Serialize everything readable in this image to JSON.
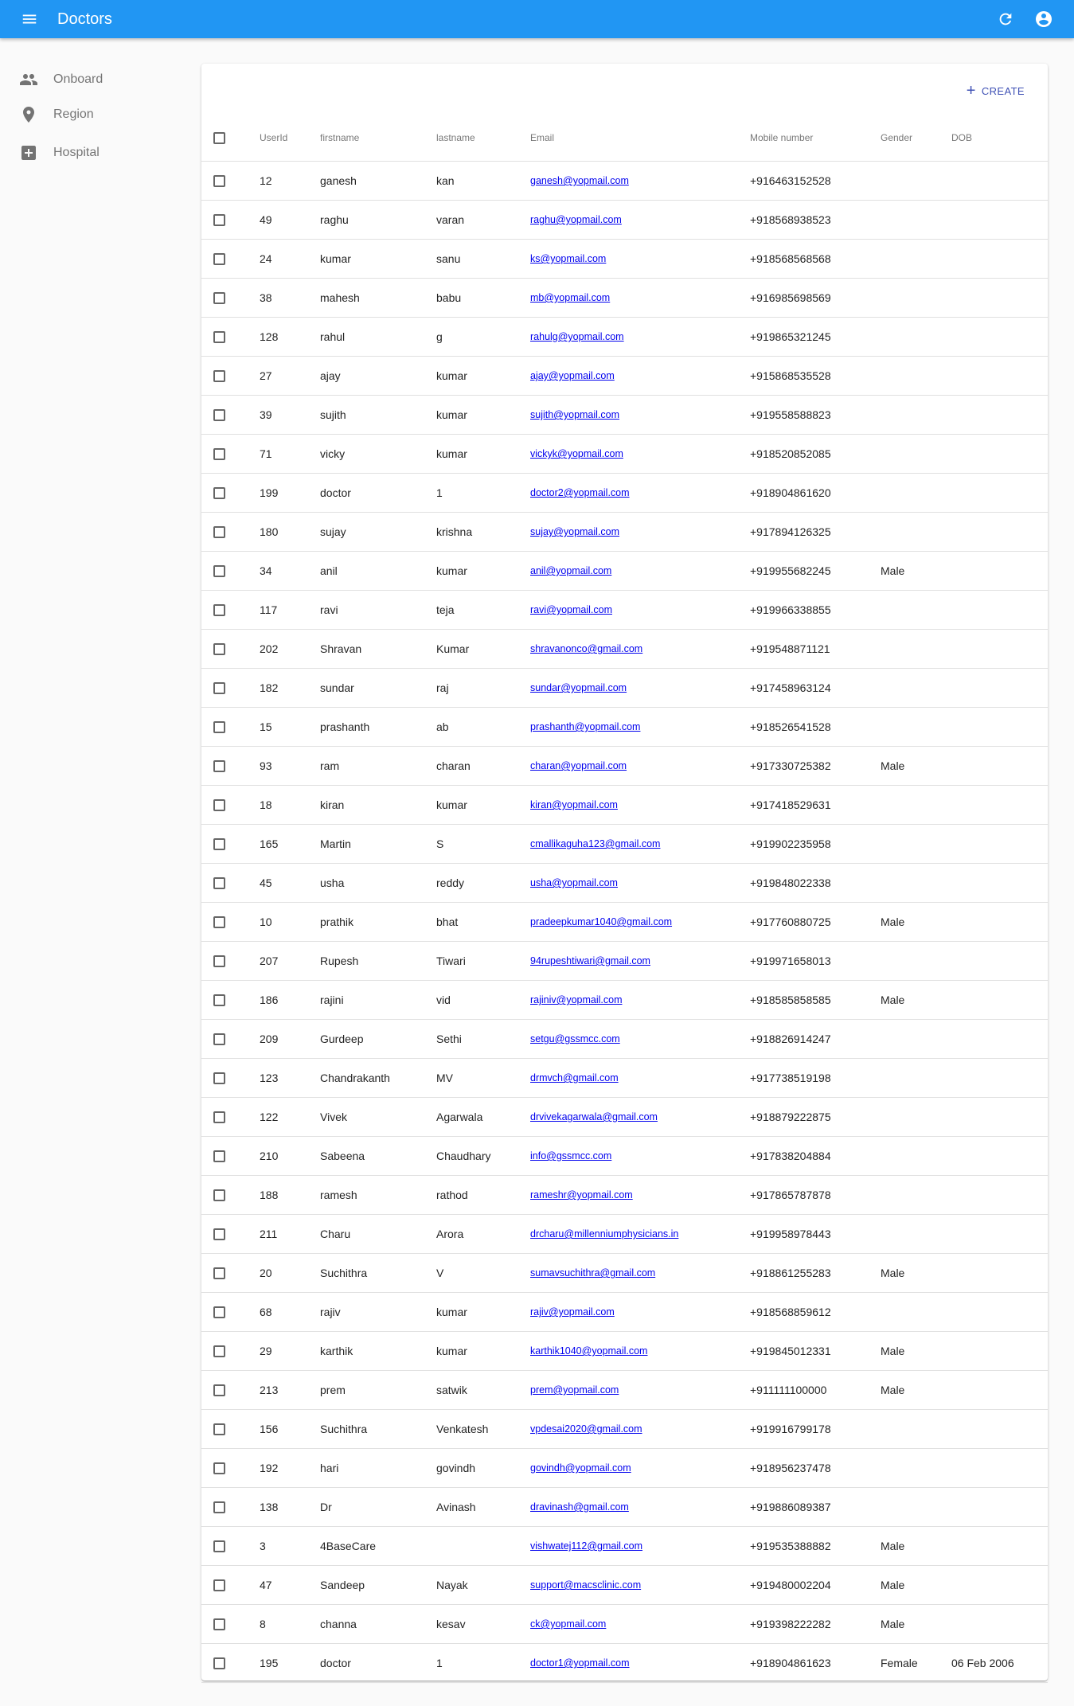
{
  "appbar": {
    "title": "Doctors",
    "menu_icon": "menu-icon",
    "refresh_icon": "refresh-icon",
    "account_icon": "account-circle-icon",
    "color": "#2196f3"
  },
  "sidebar": {
    "items": [
      {
        "label": "Onboard",
        "icon": "people-icon"
      },
      {
        "label": "Region",
        "icon": "location-pin-icon"
      },
      {
        "label": "Hospital",
        "icon": "hospital-plus-icon"
      }
    ]
  },
  "toolbar": {
    "create_label": "CREATE",
    "create_icon": "plus-icon",
    "accent": "#3f51b5"
  },
  "table": {
    "headers": {
      "userid": "UserId",
      "firstname": "firstname",
      "lastname": "lastname",
      "email": "Email",
      "mobile": "Mobile number",
      "gender": "Gender",
      "dob": "DOB"
    },
    "rows": [
      {
        "id": "12",
        "first": "ganesh",
        "last": "kan",
        "email": "ganesh@yopmail.com",
        "mobile": "+916463152528",
        "gender": "",
        "dob": ""
      },
      {
        "id": "49",
        "first": "raghu",
        "last": "varan",
        "email": "raghu@yopmail.com",
        "mobile": "+918568938523",
        "gender": "",
        "dob": ""
      },
      {
        "id": "24",
        "first": "kumar",
        "last": "sanu",
        "email": "ks@yopmail.com",
        "mobile": "+918568568568",
        "gender": "",
        "dob": ""
      },
      {
        "id": "38",
        "first": "mahesh",
        "last": "babu",
        "email": "mb@yopmail.com",
        "mobile": "+916985698569",
        "gender": "",
        "dob": ""
      },
      {
        "id": "128",
        "first": "rahul",
        "last": "g",
        "email": "rahulg@yopmail.com",
        "mobile": "+919865321245",
        "gender": "",
        "dob": ""
      },
      {
        "id": "27",
        "first": "ajay",
        "last": "kumar",
        "email": "ajay@yopmail.com",
        "mobile": "+915868535528",
        "gender": "",
        "dob": ""
      },
      {
        "id": "39",
        "first": "sujith",
        "last": "kumar",
        "email": "sujith@yopmail.com",
        "mobile": "+919558588823",
        "gender": "",
        "dob": ""
      },
      {
        "id": "71",
        "first": "vicky",
        "last": "kumar",
        "email": "vickyk@yopmail.com",
        "mobile": "+918520852085",
        "gender": "",
        "dob": ""
      },
      {
        "id": "199",
        "first": "doctor",
        "last": "1",
        "email": "doctor2@yopmail.com",
        "mobile": "+918904861620",
        "gender": "",
        "dob": ""
      },
      {
        "id": "180",
        "first": "sujay",
        "last": "krishna",
        "email": "sujay@yopmail.com",
        "mobile": "+917894126325",
        "gender": "",
        "dob": ""
      },
      {
        "id": "34",
        "first": "anil",
        "last": "kumar",
        "email": "anil@yopmail.com",
        "mobile": "+919955682245",
        "gender": "Male",
        "dob": ""
      },
      {
        "id": "117",
        "first": "ravi",
        "last": "teja",
        "email": "ravi@yopmail.com",
        "mobile": "+919966338855",
        "gender": "",
        "dob": ""
      },
      {
        "id": "202",
        "first": "Shravan",
        "last": "Kumar",
        "email": "shravanonco@gmail.com",
        "mobile": "+919548871121",
        "gender": "",
        "dob": ""
      },
      {
        "id": "182",
        "first": "sundar",
        "last": "raj",
        "email": "sundar@yopmail.com",
        "mobile": "+917458963124",
        "gender": "",
        "dob": ""
      },
      {
        "id": "15",
        "first": "prashanth",
        "last": "ab",
        "email": "prashanth@yopmail.com",
        "mobile": "+918526541528",
        "gender": "",
        "dob": ""
      },
      {
        "id": "93",
        "first": "ram",
        "last": "charan",
        "email": "charan@yopmail.com",
        "mobile": "+917330725382",
        "gender": "Male",
        "dob": ""
      },
      {
        "id": "18",
        "first": "kiran",
        "last": "kumar",
        "email": "kiran@yopmail.com",
        "mobile": "+917418529631",
        "gender": "",
        "dob": ""
      },
      {
        "id": "165",
        "first": "Martin",
        "last": "S",
        "email": "cmallikaguha123@gmail.com",
        "mobile": "+919902235958",
        "gender": "",
        "dob": ""
      },
      {
        "id": "45",
        "first": "usha",
        "last": "reddy",
        "email": "usha@yopmail.com",
        "mobile": "+919848022338",
        "gender": "",
        "dob": ""
      },
      {
        "id": "10",
        "first": "prathik",
        "last": "bhat",
        "email": "pradeepkumar1040@gmail.com",
        "mobile": "+917760880725",
        "gender": "Male",
        "dob": ""
      },
      {
        "id": "207",
        "first": "Rupesh",
        "last": "Tiwari",
        "email": "94rupeshtiwari@gmail.com",
        "mobile": "+919971658013",
        "gender": "",
        "dob": ""
      },
      {
        "id": "186",
        "first": "rajini",
        "last": "vid",
        "email": "rajiniv@yopmail.com",
        "mobile": "+918585858585",
        "gender": "Male",
        "dob": ""
      },
      {
        "id": "209",
        "first": "Gurdeep",
        "last": "Sethi",
        "email": "setgu@gssmcc.com",
        "mobile": "+918826914247",
        "gender": "",
        "dob": ""
      },
      {
        "id": "123",
        "first": "Chandrakanth",
        "last": "MV",
        "email": "drmvch@gmail.com",
        "mobile": "+917738519198",
        "gender": "",
        "dob": ""
      },
      {
        "id": "122",
        "first": "Vivek",
        "last": "Agarwala",
        "email": "drvivekagarwala@gmail.com",
        "mobile": "+918879222875",
        "gender": "",
        "dob": ""
      },
      {
        "id": "210",
        "first": "Sabeena",
        "last": "Chaudhary",
        "email": "info@gssmcc.com",
        "mobile": "+917838204884",
        "gender": "",
        "dob": ""
      },
      {
        "id": "188",
        "first": "ramesh",
        "last": "rathod",
        "email": "rameshr@yopmail.com",
        "mobile": "+917865787878",
        "gender": "",
        "dob": ""
      },
      {
        "id": "211",
        "first": "Charu",
        "last": "Arora",
        "email": "drcharu@millenniumphysicians.in",
        "mobile": "+919958978443",
        "gender": "",
        "dob": ""
      },
      {
        "id": "20",
        "first": "Suchithra",
        "last": "V",
        "email": "sumavsuchithra@gmail.com",
        "mobile": "+918861255283",
        "gender": "Male",
        "dob": ""
      },
      {
        "id": "68",
        "first": "rajiv",
        "last": "kumar",
        "email": "rajiv@yopmail.com",
        "mobile": "+918568859612",
        "gender": "",
        "dob": ""
      },
      {
        "id": "29",
        "first": "karthik",
        "last": "kumar",
        "email": "karthik1040@yopmail.com",
        "mobile": "+919845012331",
        "gender": "Male",
        "dob": ""
      },
      {
        "id": "213",
        "first": "prem",
        "last": "satwik",
        "email": "prem@yopmail.com",
        "mobile": "+911111100000",
        "gender": "Male",
        "dob": ""
      },
      {
        "id": "156",
        "first": "Suchithra",
        "last": "Venkatesh",
        "email": "vpdesai2020@gmail.com",
        "mobile": "+919916799178",
        "gender": "",
        "dob": ""
      },
      {
        "id": "192",
        "first": "hari",
        "last": "govindh",
        "email": "govindh@yopmail.com",
        "mobile": "+918956237478",
        "gender": "",
        "dob": ""
      },
      {
        "id": "138",
        "first": "Dr",
        "last": "Avinash",
        "email": "dravinash@gmail.com",
        "mobile": "+919886089387",
        "gender": "",
        "dob": ""
      },
      {
        "id": "3",
        "first": "4BaseCare",
        "last": "",
        "email": "vishwatej112@gmail.com",
        "mobile": "+919535388882",
        "gender": "Male",
        "dob": ""
      },
      {
        "id": "47",
        "first": "Sandeep",
        "last": "Nayak",
        "email": "support@macsclinic.com",
        "mobile": "+919480002204",
        "gender": "Male",
        "dob": ""
      },
      {
        "id": "8",
        "first": "channa",
        "last": "kesav",
        "email": "ck@yopmail.com",
        "mobile": "+919398222282",
        "gender": "Male",
        "dob": ""
      },
      {
        "id": "195",
        "first": "doctor",
        "last": "1",
        "email": "doctor1@yopmail.com",
        "mobile": "+918904861623",
        "gender": "Female",
        "dob": "06 Feb 2006"
      }
    ]
  }
}
